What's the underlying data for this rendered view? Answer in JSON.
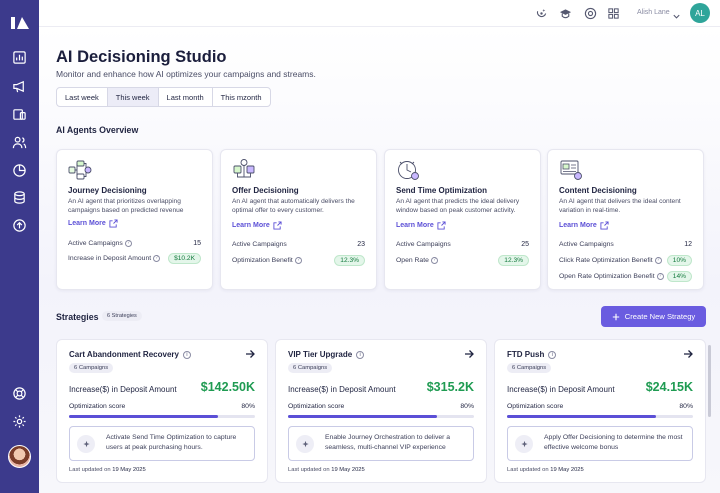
{
  "topbar": {
    "user_name": "Alish Lane",
    "avatar_initials": "AL",
    "icons": [
      "sparkle-refresh-icon",
      "graduation-cap-icon",
      "support-icon",
      "grid-icon"
    ]
  },
  "page": {
    "title": "AI Decisioning Studio",
    "subtitle": "Monitor and enhance how AI optimizes your campaigns and streams."
  },
  "tabs": [
    {
      "label": "Last week",
      "active": false
    },
    {
      "label": "This week",
      "active": true
    },
    {
      "label": "Last month",
      "active": false
    },
    {
      "label": "This mzonth",
      "active": false
    }
  ],
  "agents_section": {
    "title": "AI Agents Overview",
    "learn_more": "Learn More",
    "agents": [
      {
        "name": "Journey Decisioning",
        "description": "An AI agent that prioritizes overlapping campaigns based on predicted revenue",
        "metrics": [
          {
            "label": "Active Campaigns",
            "value": "15",
            "pill": false
          },
          {
            "label": "Increase in Deposit Amount",
            "value": "$10.2K",
            "pill": true
          }
        ]
      },
      {
        "name": "Offer Decisioning",
        "description": "An AI agent that automatically delivers the optimal offer to every customer.",
        "metrics": [
          {
            "label": "Active Campaigns",
            "value": "23",
            "pill": false
          },
          {
            "label": "Optimization Benefit",
            "value": "12.3%",
            "pill": true
          }
        ]
      },
      {
        "name": "Send Time Optimization",
        "description": "An AI agent that predicts the ideal delivery window based on peak customer activity.",
        "metrics": [
          {
            "label": "Active Campaigns",
            "value": "25",
            "pill": false
          },
          {
            "label": "Open Rate",
            "value": "12.3%",
            "pill": true
          }
        ]
      },
      {
        "name": "Content Decisioning",
        "description": "An AI agent that delivers the ideal content variation in real-time.",
        "metrics": [
          {
            "label": "Active Campaigns",
            "value": "12",
            "pill": false
          },
          {
            "label": "Click Rate Optimization Benefit",
            "value": "10%",
            "pill": true
          },
          {
            "label": "Open Rate Optimization Benefit",
            "value": "14%",
            "pill": true
          }
        ]
      }
    ]
  },
  "strategies_section": {
    "title": "Strategies",
    "count_badge": "6 Strategies",
    "create_label": "Create New Strategy",
    "strategies": [
      {
        "name": "Cart Abandonment Recovery",
        "campaigns": "6 Campaigns",
        "increase_label": "Increase($) in Deposit Amount",
        "increase_value": "$142.50K",
        "score_label": "Optimization score",
        "score_text": "80%",
        "score_value": 0.8,
        "tip": "Activate Send Time Optimization to capture users at peak purchasing hours.",
        "updated_prefix": "Last updated on",
        "updated_date": "19 May 2025"
      },
      {
        "name": "VIP Tier Upgrade",
        "campaigns": "6 Campaigns",
        "increase_label": "Increase($) in Deposit Amount",
        "increase_value": "$315.2K",
        "score_label": "Optimization score",
        "score_text": "80%",
        "score_value": 0.8,
        "tip": "Enable Journey Orchestration to deliver a seamless, multi-channel VIP experience",
        "updated_prefix": "Last updated on",
        "updated_date": "19 May 2025"
      },
      {
        "name": "FTD Push",
        "campaigns": "6 Campaigns",
        "increase_label": "Increase($) in Deposit Amount",
        "increase_value": "$24.15K",
        "score_label": "Optimization score",
        "score_text": "80%",
        "score_value": 0.8,
        "tip": "Apply Offer Decisioning to determine the most effective welcome bonus",
        "updated_prefix": "Last updated on",
        "updated_date": "19 May 2025"
      }
    ]
  },
  "colors": {
    "sidebar": "#3c3a8c",
    "accent": "#6a5ce0",
    "positive": "#1f9b52"
  }
}
